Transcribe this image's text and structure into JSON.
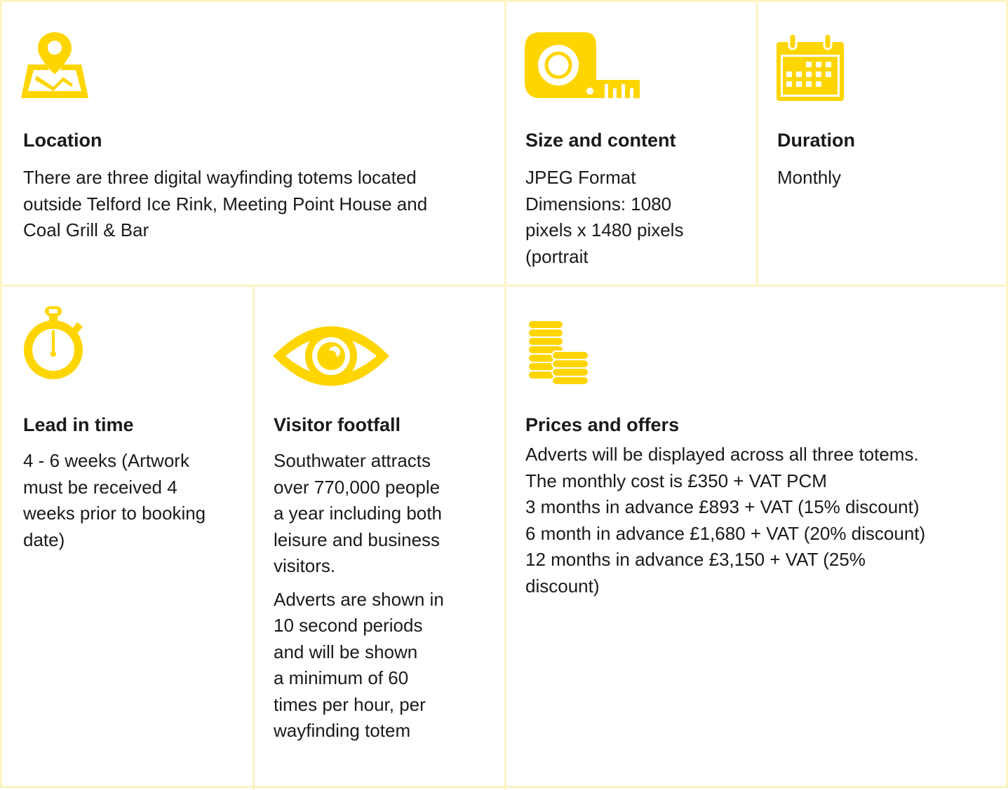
{
  "accent_color": "#FFD500",
  "border_color": "#FDF2C4",
  "cards": {
    "location": {
      "icon": "map-pin-icon",
      "title": "Location",
      "lines": [
        "There are three digital wayfinding totems located",
        "outside Telford Ice Rink, Meeting Point House and",
        "Coal Grill & Bar"
      ]
    },
    "size": {
      "icon": "tape-measure-icon",
      "title": "Size and content",
      "lines": [
        "JPEG Format",
        "Dimensions: 1080",
        "pixels x 1480 pixels",
        "(portrait"
      ]
    },
    "duration": {
      "icon": "calendar-icon",
      "title": "Duration",
      "lines": [
        "Monthly"
      ]
    },
    "lead": {
      "icon": "stopwatch-icon",
      "title": "Lead in time",
      "lines": [
        "4 - 6 weeks (Artwork",
        "must be received 4",
        "weeks prior to booking",
        "date)"
      ]
    },
    "footfall": {
      "icon": "eye-icon",
      "title": "Visitor footfall",
      "lines": [
        "Southwater attracts",
        "over 770,000 people",
        "a year including both",
        "leisure and business",
        "visitors."
      ],
      "lines2": [
        "Adverts are shown in",
        "10 second periods",
        "and will be shown",
        "a minimum of 60",
        "times per hour, per",
        "wayfinding totem"
      ]
    },
    "prices": {
      "icon": "coins-icon",
      "title": "Prices and offers",
      "lines": [
        "Adverts will be displayed across all three totems.",
        "The monthly cost is £350 + VAT PCM",
        "3 months in advance £893 + VAT (15% discount)",
        "6 month in advance £1,680 + VAT (20% discount)",
        "12 months in advance £3,150 + VAT (25%",
        "discount)"
      ]
    }
  }
}
